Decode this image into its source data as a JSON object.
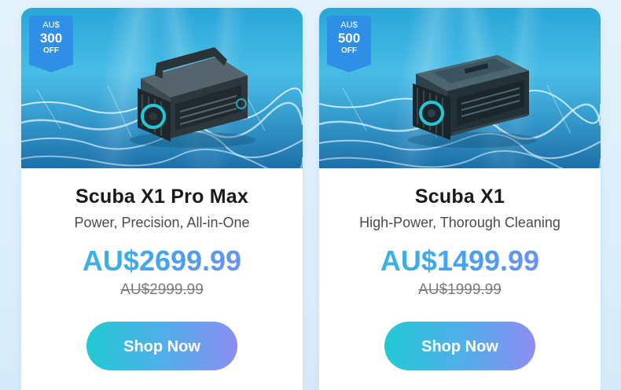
{
  "colors": {
    "page_background": "#dceefa",
    "badge_blue": "#2f8ee6",
    "price_gradient_start": "#2bc3d8",
    "price_gradient_end": "#8a86f0",
    "button_gradient_start": "#22c9d4",
    "button_gradient_end": "#8c8df2"
  },
  "products": [
    {
      "badge": {
        "currency": "AU$",
        "amount": "300",
        "off": "OFF"
      },
      "image_icon": "pool-robot-icon",
      "title": "Scuba X1 Pro Max",
      "subtitle": "Power, Precision, All-in-One",
      "price": "AU$2699.99",
      "old_price": "AU$2999.99",
      "button_label": "Shop Now"
    },
    {
      "badge": {
        "currency": "AU$",
        "amount": "500",
        "off": "OFF"
      },
      "image_icon": "pool-robot-icon",
      "title": "Scuba X1",
      "subtitle": "High-Power, Thorough Cleaning",
      "price": "AU$1499.99",
      "old_price": "AU$1999.99",
      "button_label": "Shop Now"
    }
  ]
}
